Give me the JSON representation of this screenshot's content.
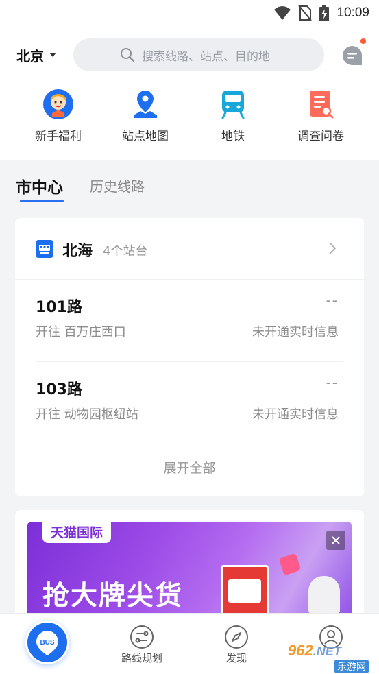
{
  "status_bar": {
    "time": "10:09"
  },
  "header": {
    "city": "北京",
    "search_placeholder": "搜索线路、站点、目的地"
  },
  "quick_actions": [
    {
      "label": "新手福利",
      "icon": "gift-mascot-icon"
    },
    {
      "label": "站点地图",
      "icon": "map-pin-icon"
    },
    {
      "label": "地铁",
      "icon": "subway-icon"
    },
    {
      "label": "调查问卷",
      "icon": "survey-icon"
    }
  ],
  "tabs": {
    "active": "市中心",
    "history": "历史线路"
  },
  "station_card": {
    "station_name": "北海",
    "station_count": "4个站台",
    "routes": [
      {
        "name": "101路",
        "direction": "开往 百万庄西口",
        "eta": "--",
        "status": "未开通实时信息"
      },
      {
        "name": "103路",
        "direction": "开往 动物园枢纽站",
        "eta": "--",
        "status": "未开通实时信息"
      }
    ],
    "expand_label": "展开全部"
  },
  "ad": {
    "tag": "天猫国际",
    "slogan": "抢大牌尖货"
  },
  "bottom_nav": {
    "bus_badge": "BUS",
    "route_plan": "路线规划",
    "discover": "发现"
  },
  "watermark": {
    "brand": "962",
    "suffix": ".NET",
    "sub": "乐游网"
  },
  "colors": {
    "accent": "#2a70f0",
    "bus_blue": "#1e6ff0",
    "notification": "#ff5a36",
    "ad_purple": "#7b2fd6"
  }
}
